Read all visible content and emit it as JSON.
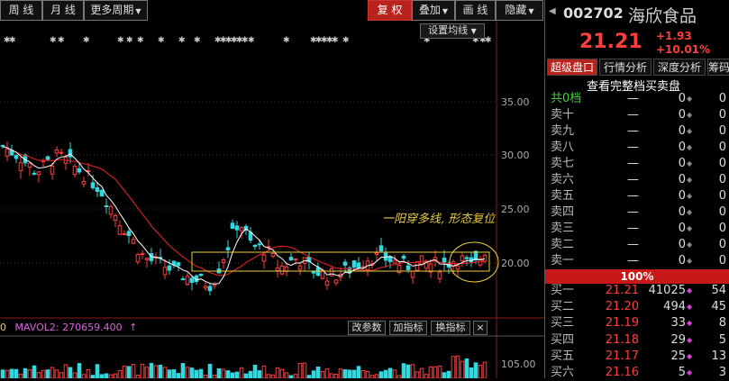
{
  "toolbar": {
    "items": [
      {
        "label": "周 线",
        "active": false
      },
      {
        "label": "月 线",
        "active": false
      },
      {
        "label": "更多周期",
        "active": false,
        "dropdown": true
      },
      {
        "label": "复 权",
        "active": true
      },
      {
        "label": "叠加",
        "active": false,
        "dropdown": true
      },
      {
        "label": "画 线",
        "active": false
      },
      {
        "label": "隐藏",
        "active": false,
        "dropdown": true
      }
    ]
  },
  "chart": {
    "set_ma_button": "设置均线",
    "y_ticks": [
      "35.00",
      "30.00",
      "25.00",
      "20.00"
    ],
    "annotation": "一阳穿多线, 形态复位",
    "volume_label": "MAVOL2: 270659.400",
    "volume_left": "0",
    "volume_y_top": "105.00",
    "buttons": {
      "modify_params": "改参数",
      "add_indicator": "加指标",
      "switch_indicator": "换指标",
      "close": "×"
    }
  },
  "stock": {
    "code": "002702",
    "name": "海欣食品",
    "price": "21.21",
    "change": "+1.93",
    "change_pct": "+10.01%"
  },
  "tabs": [
    "超级盘口",
    "行情分析",
    "深度分析",
    "筹码"
  ],
  "order_book": {
    "full_label": "查看完整档买卖盘",
    "total_ask": {
      "label": "共0档",
      "price": "—",
      "vol": "0",
      "cnt": "0"
    },
    "asks": [
      {
        "label": "卖十",
        "price": "—",
        "vol": "0",
        "cnt": "0"
      },
      {
        "label": "卖九",
        "price": "—",
        "vol": "0",
        "cnt": "0"
      },
      {
        "label": "卖八",
        "price": "—",
        "vol": "0",
        "cnt": "0"
      },
      {
        "label": "卖七",
        "price": "—",
        "vol": "0",
        "cnt": "0"
      },
      {
        "label": "卖六",
        "price": "—",
        "vol": "0",
        "cnt": "0"
      },
      {
        "label": "卖五",
        "price": "—",
        "vol": "0",
        "cnt": "0"
      },
      {
        "label": "卖四",
        "price": "—",
        "vol": "0",
        "cnt": "0"
      },
      {
        "label": "卖三",
        "price": "—",
        "vol": "0",
        "cnt": "0"
      },
      {
        "label": "卖二",
        "price": "—",
        "vol": "0",
        "cnt": "0"
      },
      {
        "label": "卖一",
        "price": "—",
        "vol": "0",
        "cnt": "0"
      }
    ],
    "ratio": "100%",
    "bids": [
      {
        "label": "买一",
        "price": "21.21",
        "vol": "41025",
        "cnt": "54"
      },
      {
        "label": "买二",
        "price": "21.20",
        "vol": "494",
        "cnt": "45"
      },
      {
        "label": "买三",
        "price": "21.19",
        "vol": "33",
        "cnt": "8"
      },
      {
        "label": "买四",
        "price": "21.18",
        "vol": "29",
        "cnt": "5"
      },
      {
        "label": "买五",
        "price": "21.17",
        "vol": "25",
        "cnt": "13"
      },
      {
        "label": "买六",
        "price": "21.16",
        "vol": "5",
        "cnt": "3"
      }
    ]
  },
  "colors": {
    "up": "#ff3d3d",
    "down": "#30d8e0",
    "ma5": "#ffffff",
    "ma20": "#e02020",
    "highlight": "#e8d040"
  }
}
